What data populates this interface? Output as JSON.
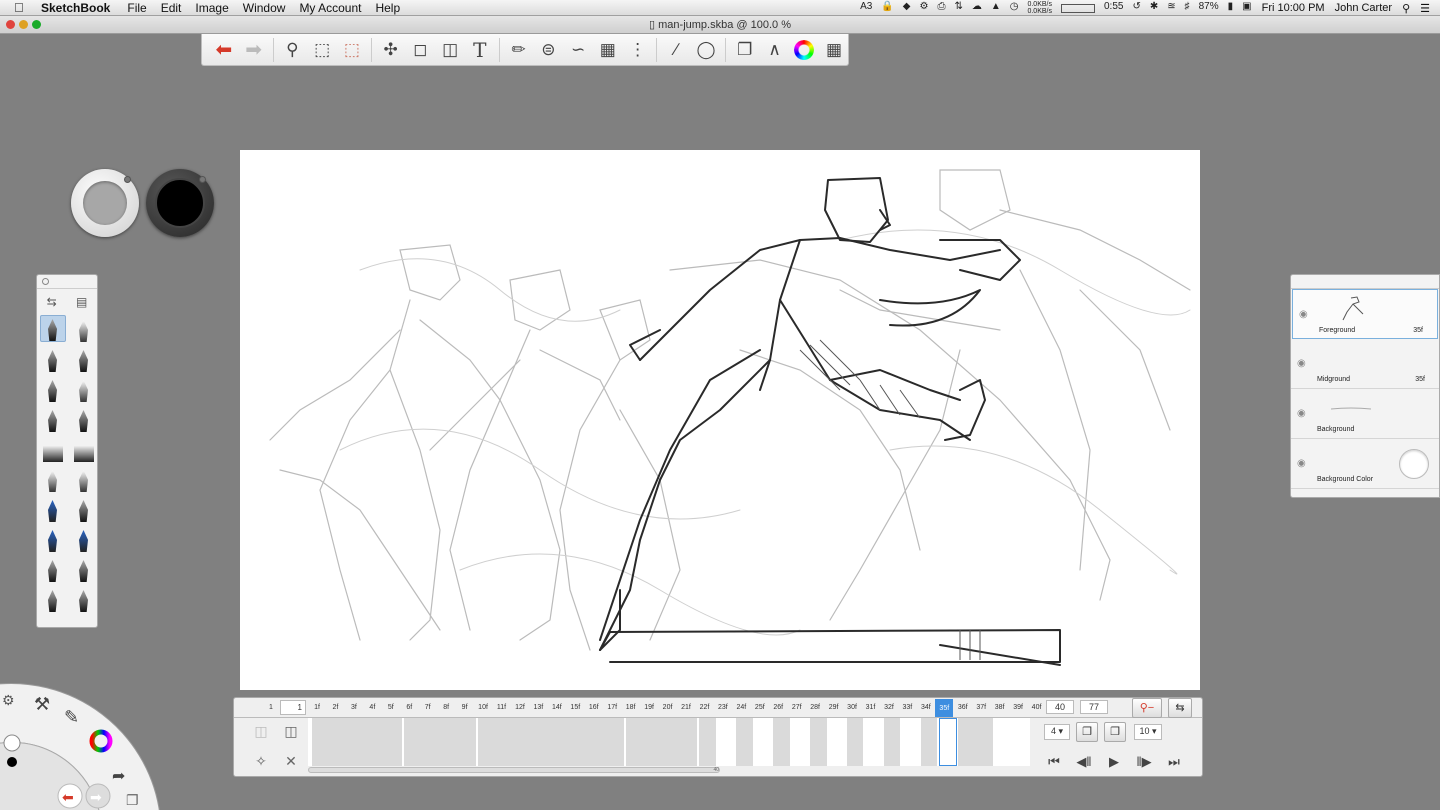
{
  "menubar": {
    "app": "SketchBook",
    "menus": [
      "File",
      "Edit",
      "Image",
      "Window",
      "My Account",
      "Help"
    ],
    "tray": {
      "ai_badge": "A3",
      "net_up": "0.0KB/s",
      "net_down": "0.0KB/s",
      "timer": "0:55",
      "battery": "87%",
      "clock": "Fri 10:00 PM",
      "user": "John Carter"
    }
  },
  "window": {
    "title": "man-jump.skba @ 100.0 %"
  },
  "toolbar": {
    "icons": [
      "undo-icon",
      "redo-icon",
      "zoom-icon",
      "rect-select-icon",
      "select-icon",
      "lasso-icon",
      "crop-icon",
      "fill-icon",
      "text-icon",
      "ruler-icon",
      "ellipse-icon",
      "french-curve-icon",
      "perspective-icon",
      "symmetry-icon",
      "stroke-icon",
      "shape-icon",
      "copy-icon",
      "brushes-icon",
      "color-wheel-icon",
      "layers-icon"
    ]
  },
  "colors": {
    "accent": "#3d8ee0",
    "undo_red": "#d53a2a",
    "puck_light": "#a7a7a7",
    "puck_dark": "#000000"
  },
  "layers": [
    {
      "name": "Foreground",
      "frame": "35f",
      "selected": true
    },
    {
      "name": "Midground",
      "frame": "35f",
      "selected": false
    },
    {
      "name": "Background",
      "frame": "",
      "selected": false
    },
    {
      "name": "Background Color",
      "frame": "",
      "selected": false
    }
  ],
  "timeline": {
    "start_field": "1",
    "ruler_start": "1",
    "frames": [
      "1f",
      "2f",
      "3f",
      "4f",
      "5f",
      "6f",
      "7f",
      "8f",
      "9f",
      "10f",
      "11f",
      "12f",
      "13f",
      "14f",
      "15f",
      "16f",
      "17f",
      "18f",
      "19f",
      "20f",
      "21f",
      "22f",
      "23f",
      "24f",
      "25f",
      "26f",
      "27f",
      "28f",
      "29f",
      "30f",
      "31f",
      "32f",
      "33f",
      "34f",
      "35f",
      "36f",
      "37f",
      "38f",
      "39f",
      "40f"
    ],
    "current_frame_index": 34,
    "end_field": "40",
    "total_field": "77",
    "fps_step": "4",
    "onion_count": "10",
    "scroll_end_label": "40"
  }
}
